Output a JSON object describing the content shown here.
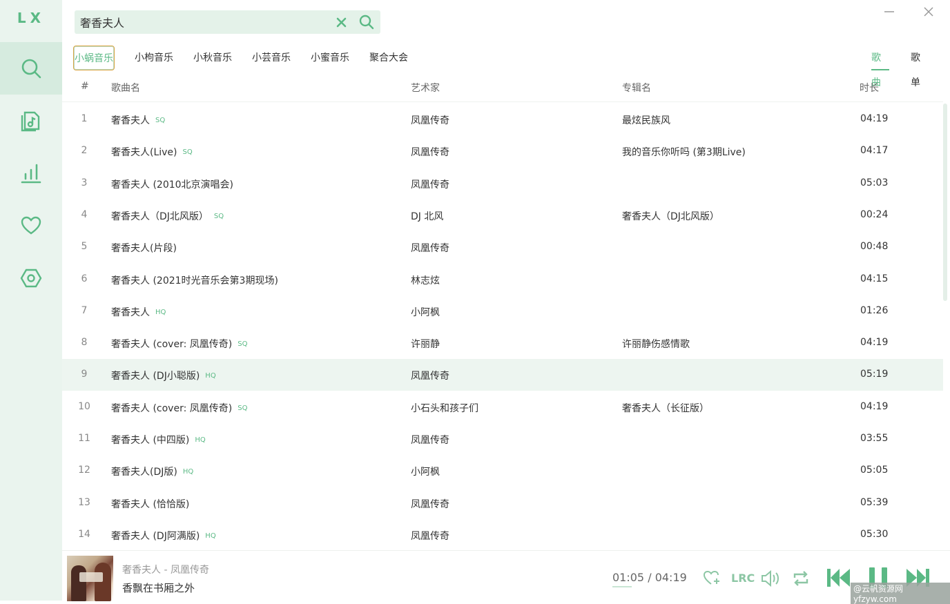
{
  "app": {
    "logo": "LX"
  },
  "colors": {
    "accent": "#5bb985",
    "sidebar_bg": "#eaf4ee",
    "active_nav_bg": "#d6ebdf",
    "search_bg": "#e4f2e9"
  },
  "sidebar": {
    "items": [
      {
        "name": "search",
        "icon": "search-icon",
        "active": true
      },
      {
        "name": "song-list",
        "icon": "music-file-icon",
        "active": false
      },
      {
        "name": "leaderboard",
        "icon": "bar-chart-icon",
        "active": false
      },
      {
        "name": "favorites",
        "icon": "heart-icon",
        "active": false
      },
      {
        "name": "settings",
        "icon": "hexagon-settings-icon",
        "active": false
      }
    ]
  },
  "search": {
    "value": "奢香夫人",
    "placeholder": ""
  },
  "sources": {
    "tabs": [
      "小蜗音乐",
      "小枸音乐",
      "小秋音乐",
      "小芸音乐",
      "小蜜音乐",
      "聚合大会"
    ],
    "active": 0
  },
  "type_tabs": {
    "tabs": [
      "歌曲",
      "歌单"
    ],
    "active": 0
  },
  "table": {
    "headers": {
      "index": "#",
      "name": "歌曲名",
      "artist": "艺术家",
      "album": "专辑名",
      "duration": "时长"
    },
    "rows": [
      {
        "index": "1",
        "name": "奢香夫人",
        "badge": "SQ",
        "artist": "凤凰传奇",
        "album": "最炫民族风",
        "duration": "04:19"
      },
      {
        "index": "2",
        "name": "奢香夫人(Live)",
        "badge": "SQ",
        "artist": "凤凰传奇",
        "album": "我的音乐你听吗 (第3期Live)",
        "duration": "04:17"
      },
      {
        "index": "3",
        "name": "奢香夫人 (2010北京演唱会)",
        "badge": "",
        "artist": "凤凰传奇",
        "album": "",
        "duration": "05:03"
      },
      {
        "index": "4",
        "name": "奢香夫人（DJ北风版）",
        "badge": "SQ",
        "artist": "DJ 北风",
        "album": "奢香夫人（DJ北风版）",
        "duration": "00:24"
      },
      {
        "index": "5",
        "name": "奢香夫人(片段)",
        "badge": "",
        "artist": "凤凰传奇",
        "album": "",
        "duration": "00:48"
      },
      {
        "index": "6",
        "name": "奢香夫人 (2021时光音乐会第3期现场)",
        "badge": "",
        "artist": "林志炫",
        "album": "",
        "duration": "04:15"
      },
      {
        "index": "7",
        "name": "奢香夫人",
        "badge": "HQ",
        "artist": "小阿枫",
        "album": "",
        "duration": "01:26"
      },
      {
        "index": "8",
        "name": "奢香夫人 (cover: 凤凰传奇)",
        "badge": "SQ",
        "artist": "许丽静",
        "album": "许丽静伤感情歌",
        "duration": "04:19"
      },
      {
        "index": "9",
        "name": "奢香夫人 (DJ小聪版)",
        "badge": "HQ",
        "artist": "凤凰传奇",
        "album": "",
        "duration": "05:19"
      },
      {
        "index": "10",
        "name": "奢香夫人 (cover: 凤凰传奇)",
        "badge": "SQ",
        "artist": "小石头和孩子们",
        "album": "奢香夫人（长征版）",
        "duration": "04:19"
      },
      {
        "index": "11",
        "name": "奢香夫人 (中四版)",
        "badge": "HQ",
        "artist": "凤凰传奇",
        "album": "",
        "duration": "03:55"
      },
      {
        "index": "12",
        "name": "奢香夫人(DJ版)",
        "badge": "HQ",
        "artist": "小阿枫",
        "album": "",
        "duration": "05:05"
      },
      {
        "index": "13",
        "name": "奢香夫人 (恰恰版)",
        "badge": "",
        "artist": "凤凰传奇",
        "album": "",
        "duration": "05:39"
      },
      {
        "index": "14",
        "name": "奢香夫人 (DJ阿满版)",
        "badge": "HQ",
        "artist": "凤凰传奇",
        "album": "",
        "duration": "05:30"
      }
    ],
    "highlighted_row": 9
  },
  "player": {
    "song": "奢香夫人 - 凤凰传奇",
    "lyric": "香飘在书厢之外",
    "current": "01:05",
    "separator": "/",
    "total": "04:19",
    "lrc_label": "LRC",
    "watermark": "@云帆资源网 yfzyw.com"
  }
}
